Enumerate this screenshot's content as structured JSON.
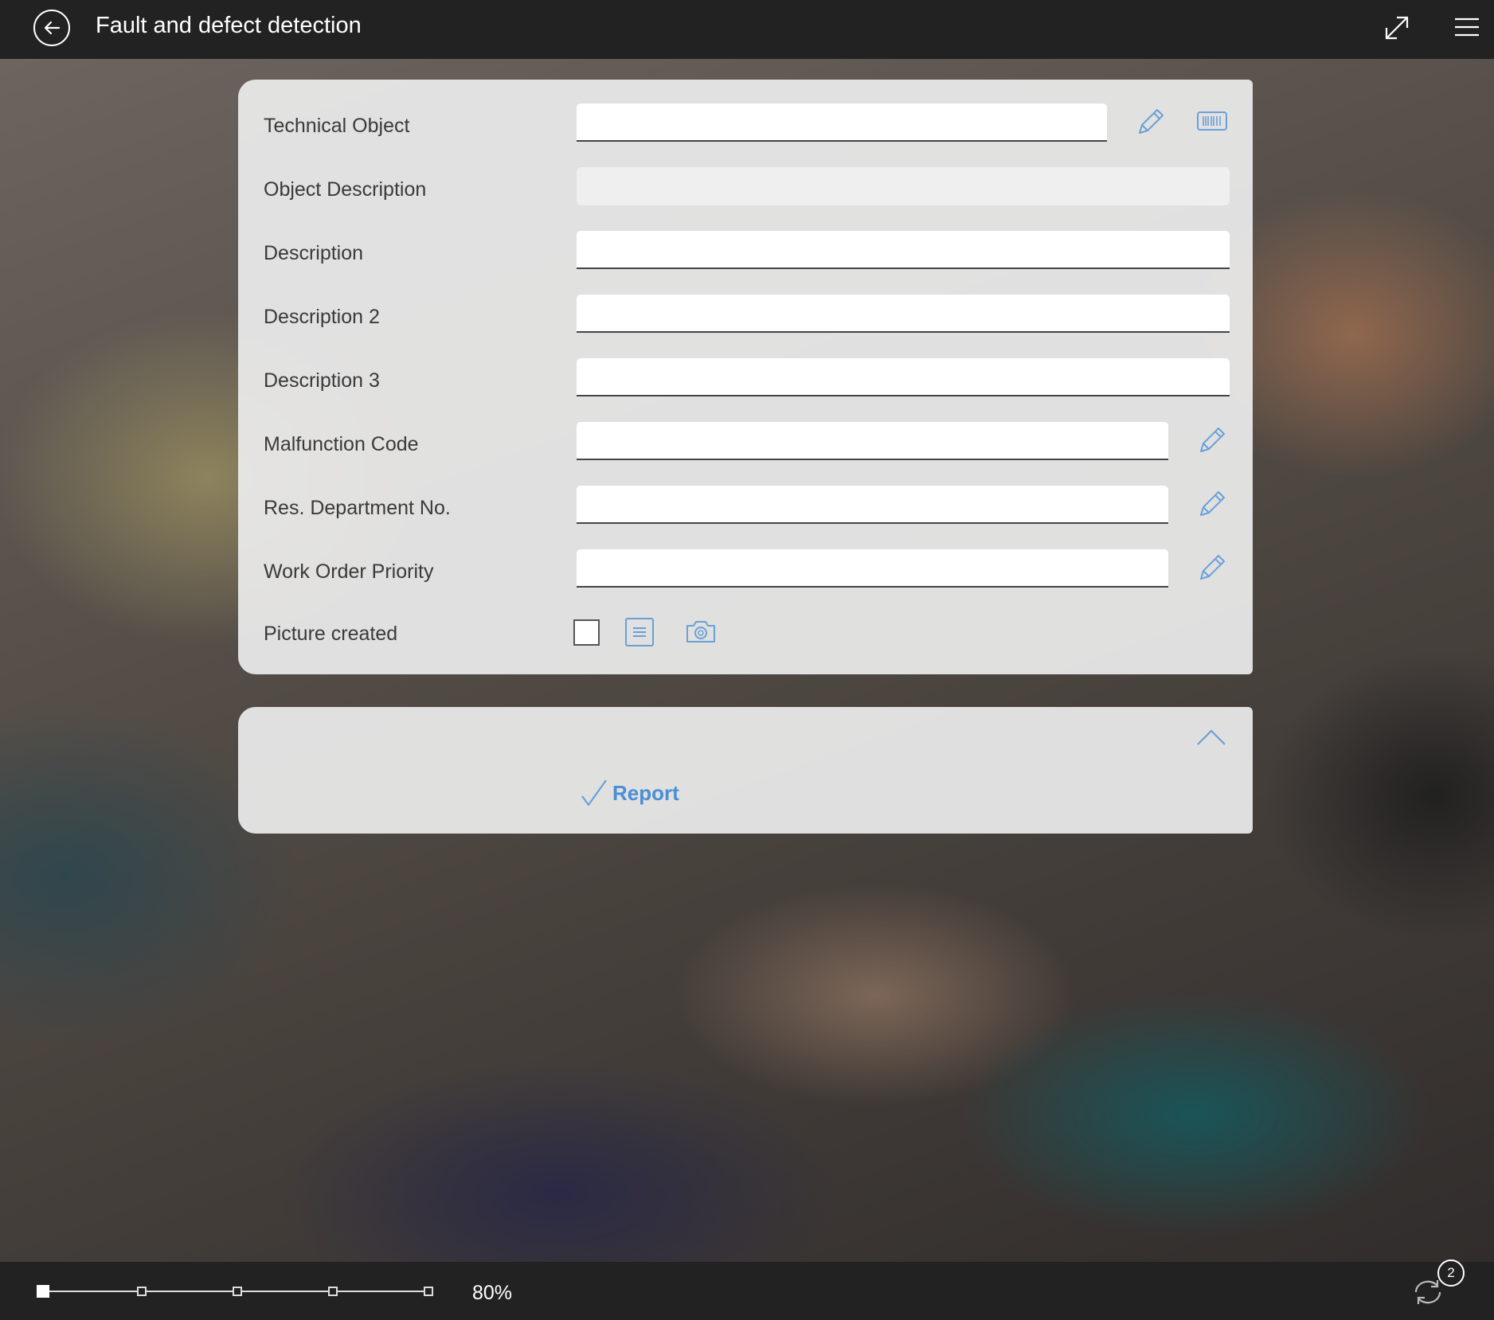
{
  "header": {
    "title": "Fault and defect detection",
    "back_icon": "back-arrow-icon",
    "expand_icon": "expand-icon",
    "menu_icon": "hamburger-menu-icon"
  },
  "form": {
    "fields": [
      {
        "label": "Technical Object",
        "value": "",
        "actions": [
          "edit-icon",
          "barcode-icon"
        ]
      },
      {
        "label": "Object Description",
        "value": "",
        "readonly": true
      },
      {
        "label": "Description",
        "value": ""
      },
      {
        "label": "Description 2",
        "value": ""
      },
      {
        "label": "Description 3",
        "value": ""
      },
      {
        "label": "Malfunction Code",
        "value": "",
        "actions": [
          "edit-icon"
        ]
      },
      {
        "label": "Res. Department No.",
        "value": "",
        "actions": [
          "edit-icon"
        ]
      },
      {
        "label": "Work Order Priority",
        "value": "",
        "actions": [
          "edit-icon"
        ]
      }
    ],
    "picture": {
      "label": "Picture created",
      "checked": false,
      "icons": [
        "notes-icon",
        "camera-icon"
      ]
    }
  },
  "actions": {
    "report_label": "Report",
    "collapse_icon": "chevron-up-icon"
  },
  "footer": {
    "zoom_text": "80%",
    "zoom_level": 0,
    "zoom_steps": 5,
    "sync_badge": "2"
  },
  "colors": {
    "bar_background": "#222222",
    "accent": "#4a8fd6",
    "icon_blue": "#6aa0d8"
  }
}
